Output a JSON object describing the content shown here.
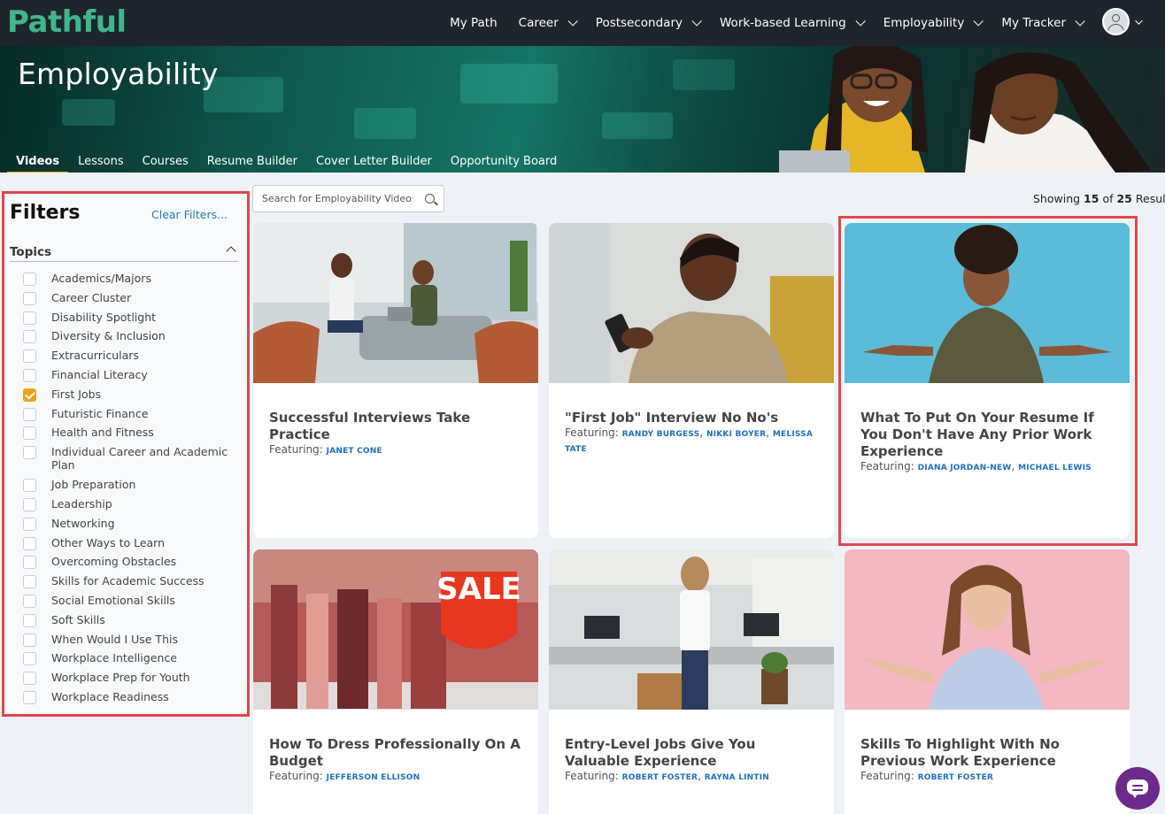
{
  "nav": {
    "logo": "Pathful",
    "items": [
      {
        "label": "My Path",
        "dropdown": false
      },
      {
        "label": "Career",
        "dropdown": true
      },
      {
        "label": "Postsecondary",
        "dropdown": true
      },
      {
        "label": "Work-based Learning",
        "dropdown": true
      },
      {
        "label": "Employability",
        "dropdown": true
      },
      {
        "label": "My Tracker",
        "dropdown": true
      }
    ]
  },
  "hero": {
    "title": "Employability",
    "tabs": [
      "Videos",
      "Lessons",
      "Courses",
      "Resume Builder",
      "Cover Letter Builder",
      "Opportunity Board"
    ],
    "active_tab": "Videos"
  },
  "filters": {
    "title": "Filters",
    "clear_label": "Clear Filters...",
    "topics_label": "Topics",
    "topics": [
      {
        "label": "Academics/Majors",
        "checked": false
      },
      {
        "label": "Career Cluster",
        "checked": false
      },
      {
        "label": "Disability Spotlight",
        "checked": false
      },
      {
        "label": "Diversity & Inclusion",
        "checked": false
      },
      {
        "label": "Extracurriculars",
        "checked": false
      },
      {
        "label": "Financial Literacy",
        "checked": false
      },
      {
        "label": "First Jobs",
        "checked": true
      },
      {
        "label": "Futuristic Finance",
        "checked": false
      },
      {
        "label": "Health and Fitness",
        "checked": false
      },
      {
        "label": "Individual Career and Academic Plan",
        "checked": false
      },
      {
        "label": "Job Preparation",
        "checked": false
      },
      {
        "label": "Leadership",
        "checked": false
      },
      {
        "label": "Networking",
        "checked": false
      },
      {
        "label": "Other Ways to Learn",
        "checked": false
      },
      {
        "label": "Overcoming Obstacles",
        "checked": false
      },
      {
        "label": "Skills for Academic Success",
        "checked": false
      },
      {
        "label": "Social Emotional Skills",
        "checked": false
      },
      {
        "label": "Soft Skills",
        "checked": false
      },
      {
        "label": "When Would I Use This",
        "checked": false
      },
      {
        "label": "Workplace Intelligence",
        "checked": false
      },
      {
        "label": "Workplace Prep for Youth",
        "checked": false
      },
      {
        "label": "Workplace Readiness",
        "checked": false
      }
    ]
  },
  "search": {
    "placeholder": "Search for Employability Videos"
  },
  "results": {
    "prefix": "Showing",
    "shown": "15",
    "of": "of",
    "total": "25",
    "suffix": "Results"
  },
  "featuring_label": "Featuring:",
  "videos": [
    {
      "title": "Successful Interviews Take Practice",
      "featuring": [
        "JANET CONE"
      ],
      "thumb": "interview"
    },
    {
      "title": "\"First Job\" Interview No No's",
      "featuring": [
        "RANDY BURGESS",
        "NIKKI BOYER",
        "MELISSA TATE"
      ],
      "thumb": "phone"
    },
    {
      "title": "What To Put On Your Resume If You Don't Have Any Prior Work Experience",
      "featuring": [
        "DIANA JORDAN-NEW",
        "MICHAEL LEWIS"
      ],
      "thumb": "shrug-blue"
    },
    {
      "title": "How To Dress Professionally On A Budget",
      "featuring": [
        "JEFFERSON ELLISON"
      ],
      "thumb": "sale",
      "thumb_text": "SALE"
    },
    {
      "title": "Entry-Level Jobs Give You Valuable Experience",
      "featuring": [
        "ROBERT FOSTER",
        "RAYNA LINTIN"
      ],
      "thumb": "office"
    },
    {
      "title": "Skills To Highlight With No Previous Work Experience",
      "featuring": [
        "ROBERT FOSTER"
      ],
      "thumb": "shrug-pink"
    }
  ],
  "colors": {
    "accent": "#f0a11c",
    "link": "#1f6fc4",
    "highlight": "#e0474c",
    "nav_bg": "#1f252c",
    "logo": "#3fb78c",
    "chat": "#6b2a8c"
  }
}
